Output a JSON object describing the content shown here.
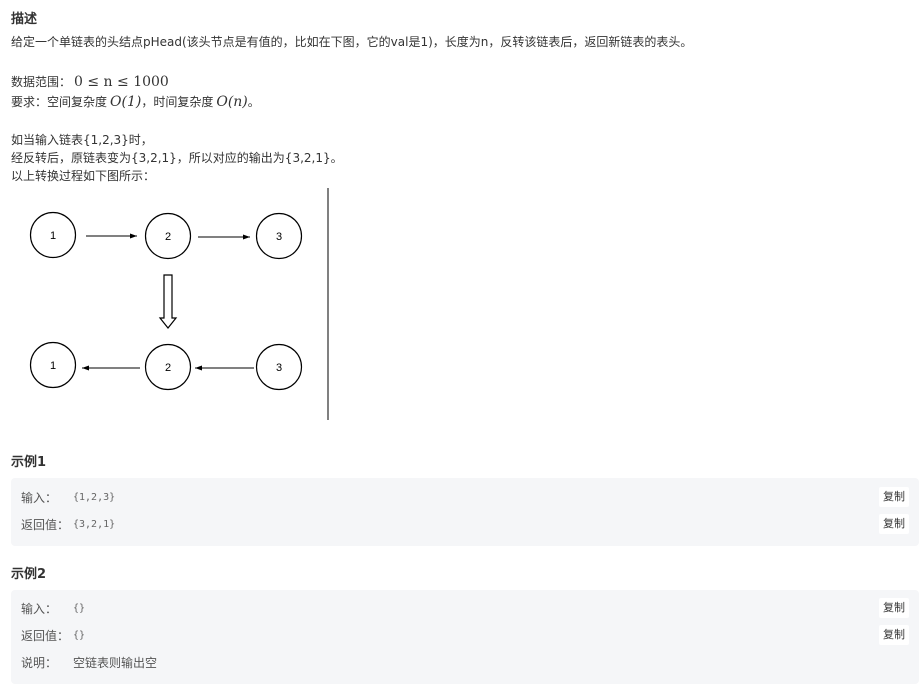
{
  "description": {
    "title": "描述",
    "intro": "给定一个单链表的头结点pHead(该头节点是有值的，比如在下图，它的val是1)，长度为n，反转该链表后，返回新链表的表头。",
    "range_label": "数据范围：",
    "range_math": "0 ≤ n ≤ 1000",
    "req_label": "要求：空间复杂度",
    "req_space": "O(1)",
    "req_mid": "，时间复杂度",
    "req_time": "O(n)",
    "req_end": "。",
    "example_line1": "如当输入链表{1,2,3}时，",
    "example_line2": "经反转后，原链表变为{3,2,1}，所以对应的输出为{3,2,1}。",
    "example_line3": "以上转换过程如下图所示："
  },
  "diagram": {
    "top_nodes": [
      "1",
      "2",
      "3"
    ],
    "bottom_nodes": [
      "1",
      "2",
      "3"
    ]
  },
  "examples": [
    {
      "title": "示例1",
      "rows": [
        {
          "label": "输入：",
          "value": "{1,2,3}",
          "copy": "复制"
        },
        {
          "label": "返回值：",
          "value": "{3,2,1}",
          "copy": "复制"
        }
      ]
    },
    {
      "title": "示例2",
      "rows": [
        {
          "label": "输入：",
          "value": "{}",
          "copy": "复制"
        },
        {
          "label": "返回值：",
          "value": "{}",
          "copy": "复制"
        }
      ],
      "note_label": "说明：",
      "note_text": "空链表则输出空"
    }
  ],
  "colors": {
    "example_bg": "#f5f6f8",
    "text": "#333333"
  }
}
